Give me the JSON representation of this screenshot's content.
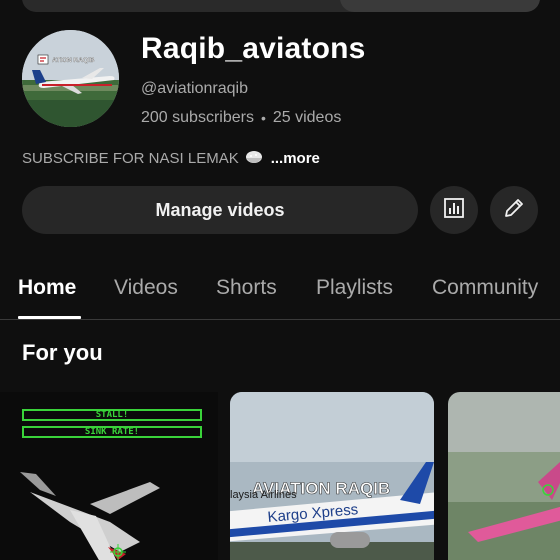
{
  "channel": {
    "name": "Raqib_aviatons",
    "handle": "@aviationraqib",
    "subscribers": "200 subscribers",
    "separator": "•",
    "videos": "25 videos",
    "description": "SUBSCRIBE FOR NASI LEMAK",
    "more_label": "...more",
    "avatar_text": "ATION RAQIB"
  },
  "actions": {
    "manage_label": "Manage videos",
    "analytics_icon": "bar-chart-icon",
    "edit_icon": "pencil-icon"
  },
  "tabs": [
    {
      "label": "Home",
      "active": true
    },
    {
      "label": "Videos",
      "active": false
    },
    {
      "label": "Shorts",
      "active": false
    },
    {
      "label": "Playlists",
      "active": false
    },
    {
      "label": "Community",
      "active": false
    }
  ],
  "section": {
    "title": "For you"
  },
  "cards": {
    "card1": {
      "warning1": "STALL!",
      "warning2": "SINK RATE!"
    },
    "card2": {
      "watermark": "AVIATION RAQIB",
      "livery": "Kargo Xpress",
      "livery_small": "laysia Airlines"
    }
  },
  "colors": {
    "background": "#0f0f0f",
    "button": "#272727",
    "text_primary": "#f1f1f1",
    "text_secondary": "#aaaaaa",
    "hud_green": "#3ad33a"
  }
}
